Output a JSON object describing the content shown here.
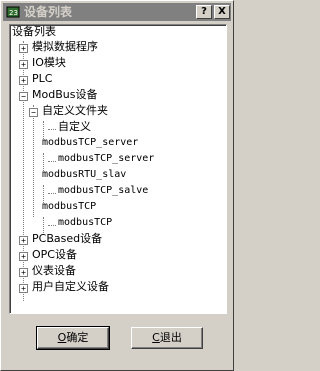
{
  "window": {
    "title": "设备列表",
    "help_label": "?",
    "close_label": "X"
  },
  "tree": {
    "root": "设备列表",
    "items": [
      {
        "label": "模拟数据程序"
      },
      {
        "label": "IO模块"
      },
      {
        "label": "PLC"
      },
      {
        "label": "ModBus设备"
      },
      {
        "label": "自定义文件夹"
      },
      {
        "label": "自定义"
      },
      {
        "label": "modbusTCP_server"
      },
      {
        "label": "modbusTCP_server"
      },
      {
        "label": "modbusRTU_slav"
      },
      {
        "label": "modbusTCP_salve"
      },
      {
        "label": "modbusTCP"
      },
      {
        "label": "modbusTCP"
      },
      {
        "label": "PCBased设备"
      },
      {
        "label": "OPC设备"
      },
      {
        "label": "仪表设备"
      },
      {
        "label": "用户自定义设备"
      }
    ]
  },
  "buttons": {
    "ok_mnemonic": "O",
    "ok_rest": "确定",
    "exit_mnemonic": "C",
    "exit_rest": "退出"
  }
}
